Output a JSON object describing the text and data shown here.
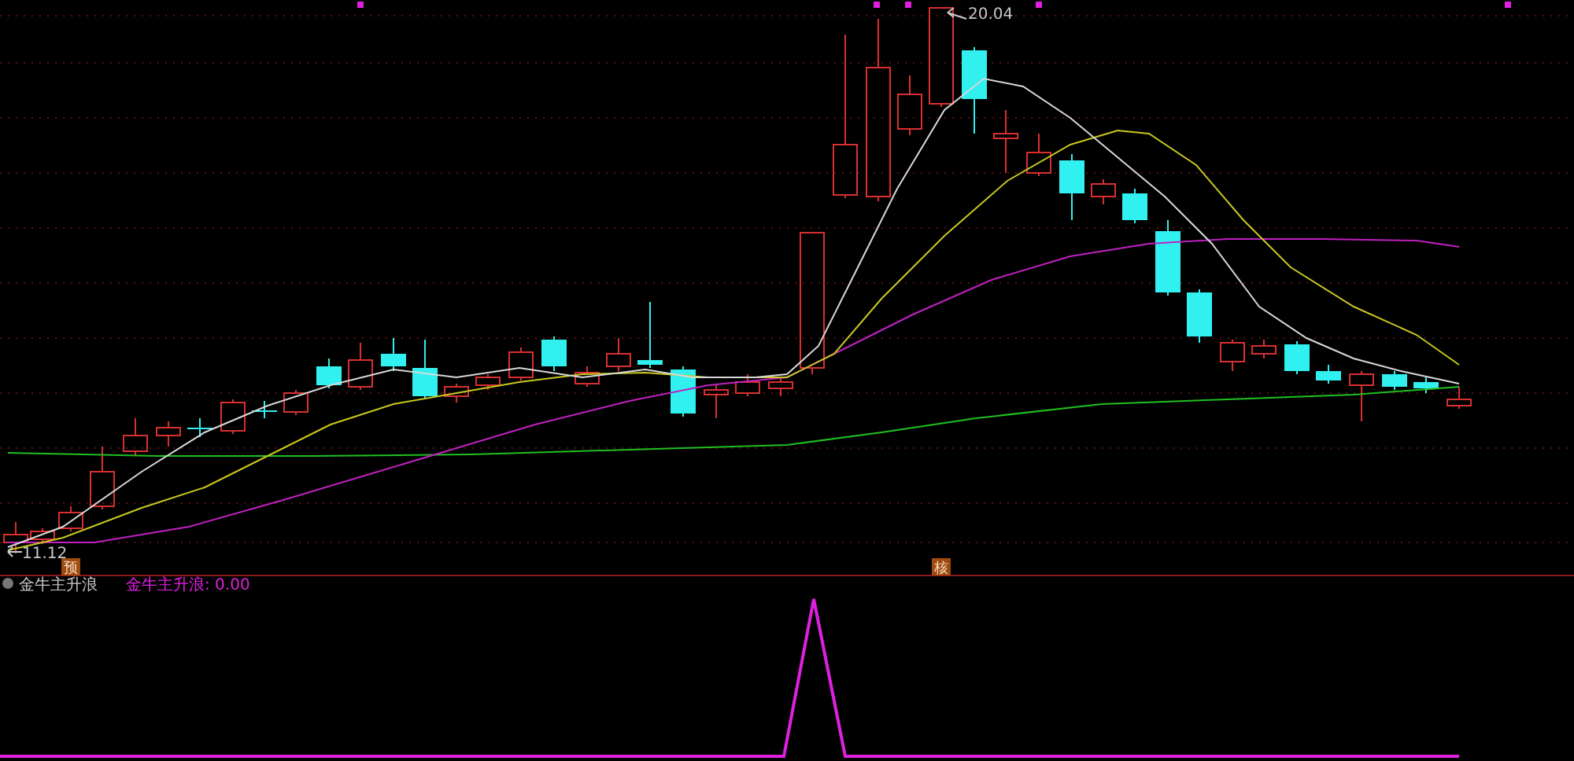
{
  "price_chart": {
    "high_label": "20.04",
    "low_label": "11.12",
    "markers": [
      {
        "text": "预"
      },
      {
        "text": "核"
      }
    ]
  },
  "indicator_panel": {
    "name": "金牛主升浪",
    "value_label": "金牛主升浪: 0.00"
  }
}
